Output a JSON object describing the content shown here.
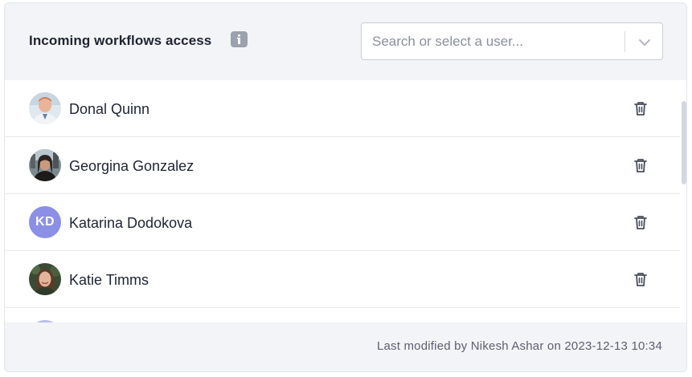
{
  "panel": {
    "title": "Incoming workflows access",
    "info_icon": "info-icon"
  },
  "user_select": {
    "placeholder": "Search or select a user...",
    "dropdown_icon": "chevron-down-icon"
  },
  "users": [
    {
      "name": "Donal Quinn",
      "avatar_type": "photo",
      "avatar_icon": "user-photo"
    },
    {
      "name": "Georgina Gonzalez",
      "avatar_type": "photo",
      "avatar_icon": "user-photo"
    },
    {
      "name": "Katarina Dodokova",
      "avatar_type": "initials",
      "initials": "KD",
      "avatar_color": "#8b8fe6"
    },
    {
      "name": "Katie Timms",
      "avatar_type": "photo",
      "avatar_icon": "user-photo"
    }
  ],
  "row_action_icon": "trash-icon",
  "footer": {
    "last_modified": "Last modified by Nikesh Ashar on 2023-12-13 10:34"
  },
  "colors": {
    "panel_bg": "#f3f4f7",
    "initials_avatar": "#8b8fe6",
    "text": "#1f2433",
    "muted_text": "#5c6170"
  }
}
